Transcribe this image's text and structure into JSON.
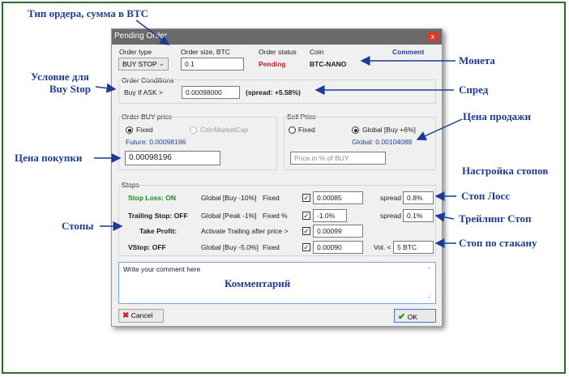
{
  "window": {
    "title": "Pending Order",
    "close": "x"
  },
  "header": {
    "order_type_label": "Order type",
    "order_type_value": "BUY STOP",
    "order_size_label": "Order size, BTC",
    "order_size_value": "0.1",
    "order_status_label": "Order status",
    "order_status_value": "Pending",
    "coin_label": "Coin",
    "coin_value": "BTC-NANO",
    "comment_label": "Comment"
  },
  "conditions": {
    "title": "Order Conditions",
    "buy_if_ask": "Buy If ASK >",
    "ask_value": "0.00098000",
    "spread": "(spread: +5.58%)"
  },
  "buy_price": {
    "title": "Order BUY price",
    "fixed": "Fixed",
    "coinmarketcap": "CoinMarketCap",
    "future": "Future: 0.00098196",
    "value": "0.00098196"
  },
  "sell_price": {
    "title": "Sell Price",
    "fixed": "Fixed",
    "global": "Global [Buy +6%]",
    "global_value": "Global: 0.00104088",
    "placeholder": "Price in % of BUY"
  },
  "stops": {
    "title": "Stops",
    "rows": [
      {
        "name": "Stop Loss: ON",
        "mode": "Global [Buy -10%]",
        "kind": "Fixed",
        "value": "0.00085",
        "extra_label": "spread",
        "extra_value": "0.8%"
      },
      {
        "name": "Trailing Stop: OFF",
        "mode": "Global [Peak -1%]",
        "kind": "Fixed %",
        "value": "-1.0%",
        "extra_label": "spread",
        "extra_value": "0.1%"
      },
      {
        "name": "Take Profit:",
        "mode": "Activate Trailing after price >",
        "kind": "",
        "value": "0.00099",
        "extra_label": "",
        "extra_value": ""
      },
      {
        "name": "VStop: OFF",
        "mode": "Global [Buy -5.0%]",
        "kind": "Fixed",
        "value": "0.00090",
        "extra_label": "Vol. <",
        "extra_value": "5 BTC"
      }
    ]
  },
  "comment_box": {
    "placeholder": "Write your comment here"
  },
  "buttons": {
    "cancel": "Cancel",
    "ok": "OK"
  },
  "annotations": {
    "order_type_size": "Тип ордера, сумма в BTC",
    "coin": "Монета",
    "buy_stop_condition_1": "Условие для",
    "buy_stop_condition_2": "Buy Stop",
    "spread": "Спред",
    "sell_price": "Цена продажи",
    "buy_price": "Цена покупки",
    "stops_settings": "Настройка стопов",
    "stop_loss": "Стоп Лосс",
    "stops": "Стопы",
    "trailing_stop": "Трейлинг Стоп",
    "vstop": "Стоп по стакану",
    "comment": "Комментарий"
  },
  "colors": {
    "accent_blue": "#1b3c94",
    "pending_red": "#d21b1b",
    "stop_on_green": "#1e8c1e",
    "frame_green": "#2f6b2f"
  }
}
